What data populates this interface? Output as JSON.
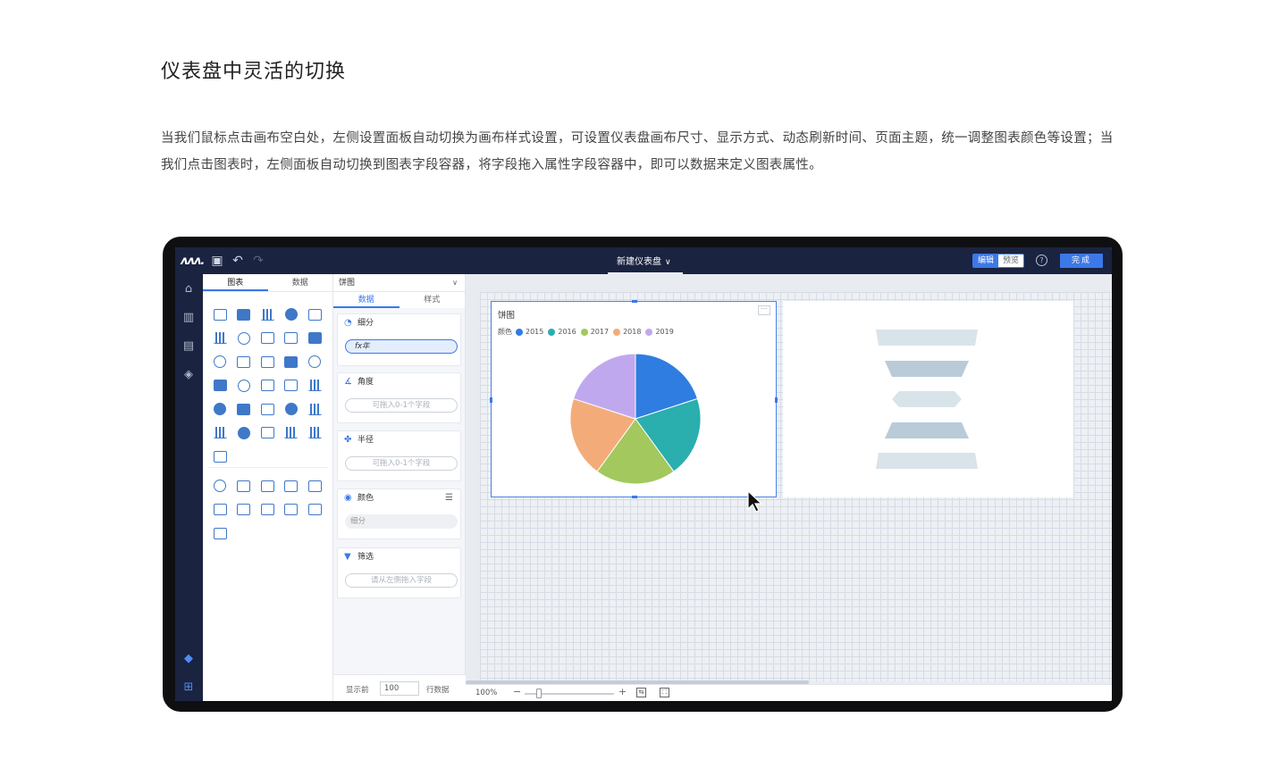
{
  "heading": "仪表盘中灵活的切换",
  "description": "当我们鼠标点击画布空白处，左侧设置面板自动切换为画布样式设置，可设置仪表盘画布尺寸、显示方式、动态刷新时间、页面主题，统一调整图表颜色等设置；当我们点击图表时，左侧面板自动切换到图表字段容器，将字段拖入属性字段容器中，即可以数据来定义图表属性。",
  "app": {
    "logo_text": "ʌʌʌ.",
    "dashboard_title": "新建仪表盘",
    "mode_edit": "编辑",
    "mode_preview": "预览",
    "help": "?",
    "done_label": "完成"
  },
  "palette": {
    "tab_charts": "图表",
    "tab_data": "数据"
  },
  "props": {
    "chart_type": "饼图",
    "tab_data": "数据",
    "tab_style": "样式",
    "sections": {
      "breakdown": {
        "label": "细分",
        "field": "fx年"
      },
      "angle": {
        "label": "角度",
        "placeholder": "可拖入0-1个字段"
      },
      "radius": {
        "label": "半径",
        "placeholder": "可拖入0-1个字段"
      },
      "color": {
        "label": "颜色",
        "field": "细分"
      },
      "filter": {
        "label": "筛选",
        "placeholder": "请从左侧拖入字段"
      }
    },
    "footer": {
      "show_first": "显示前",
      "row_count": "100",
      "rows_label": "行数据"
    }
  },
  "canvas": {
    "zoom": "100%",
    "zoom_minus": "−",
    "zoom_plus": "+",
    "zoom_level": 0.16
  },
  "chart_data": {
    "type": "pie",
    "title": "饼图",
    "legend_label": "颜色",
    "categories": [
      "2015",
      "2016",
      "2017",
      "2018",
      "2019"
    ],
    "values": [
      20,
      20,
      20,
      20,
      20
    ],
    "colors": [
      "#2f7de1",
      "#2aaeae",
      "#a2c85e",
      "#f3ac79",
      "#c0a8ee"
    ],
    "legend_position": "top-left"
  },
  "colors": {
    "accent": "#3c78e8",
    "nav_bg": "#1a2340"
  }
}
